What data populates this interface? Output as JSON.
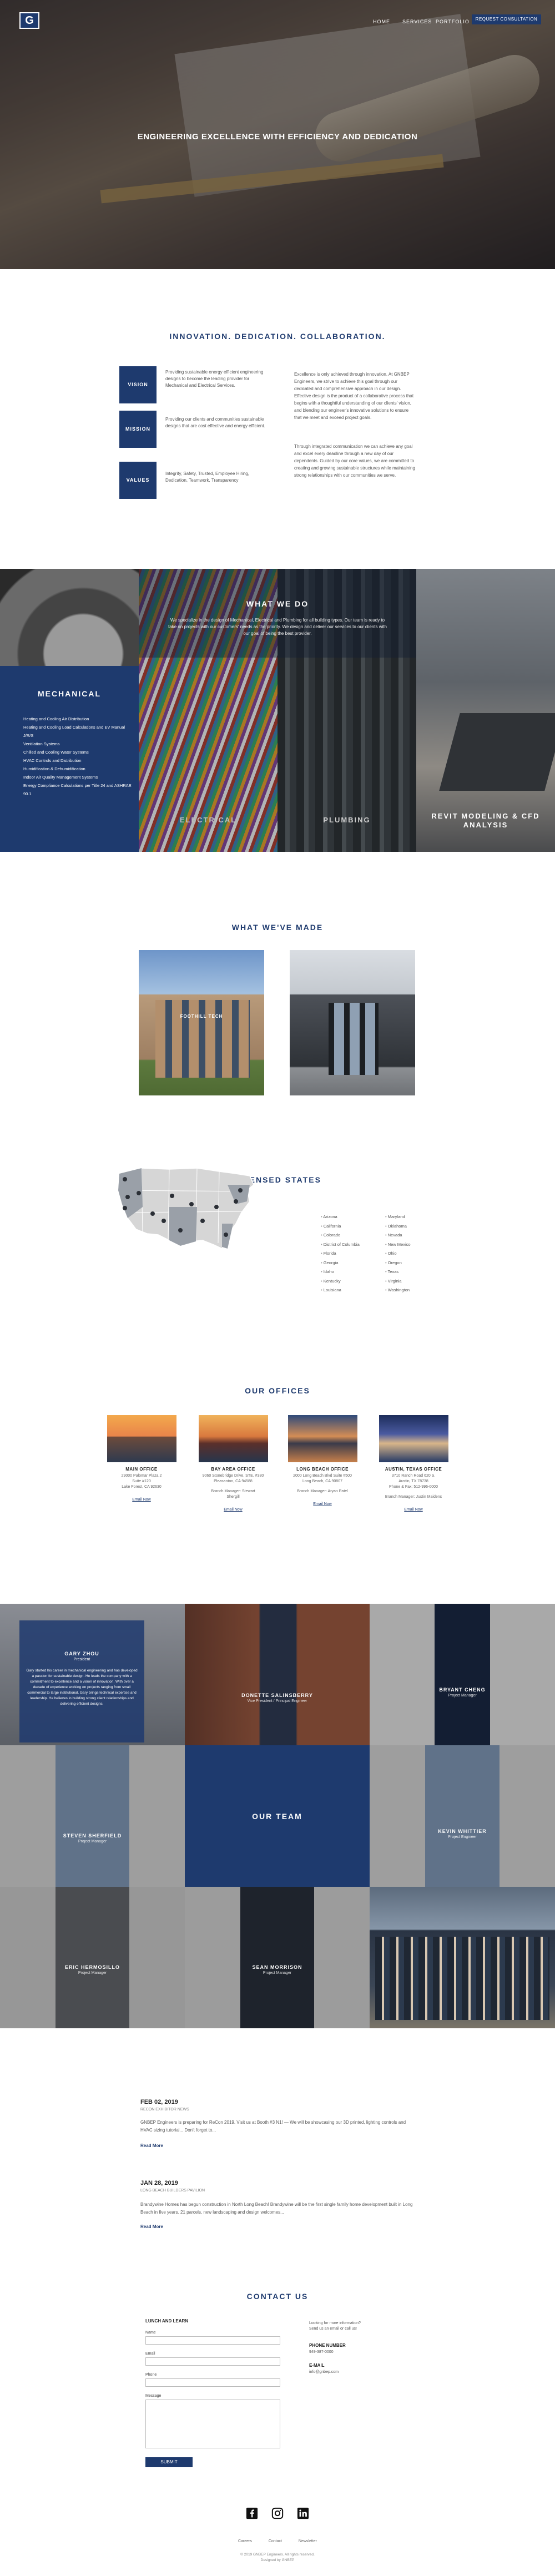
{
  "header": {
    "logo_text": "G",
    "nav": [
      "HOME",
      "SERVICES",
      "PORTFOLIO"
    ],
    "cta": "REQUEST CONSULTATION"
  },
  "hero": {
    "title": "ENGINEERING EXCELLENCE WITH EFFICIENCY AND DEDICATION"
  },
  "intro": {
    "heading": "INNOVATION. DEDICATION. COLLABORATION.",
    "values": [
      {
        "label": "VISION",
        "text": "Providing sustainable energy efficient engineering designs to become the leading provider for Mechanical and Electrical Services."
      },
      {
        "label": "MISSION",
        "text": "Providing our clients and communities sustainable designs that are cost effective and energy efficient."
      },
      {
        "label": "VALUES",
        "text": "Integrity, Safety, Trusted, Employee Hiring, Dedication, Teamwork, Transparency"
      }
    ],
    "paragraph1": "Excellence is only achieved through innovation. At GNBEP Engineers, we strive to achieve this goal through our dedicated and comprehensive approach in our design. Effective design is the product of a collaborative process that begins with a thoughtful understanding of our clients' vision, and blending our engineer's innovative solutions to ensure that we meet and exceed project goals.",
    "paragraph2": "Through integrated communication we can achieve any goal and excel every deadline through a new day of our dependents. Guided by our core values, we are committed to creating and growing sustainable structures while maintaining strong relationships with our communities we serve."
  },
  "services": {
    "heading": "WHAT WE DO",
    "text": "We specialize in the design of Mechanical, Electrical and Plumbing for all building types. Our team is ready to take on projects with our customers' needs as the priority. We design and deliver our services to our clients with our goal of being the best provider.",
    "mechanical": {
      "title": "MECHANICAL",
      "items": [
        "Heating and Cooling Air Distribution",
        "Heating and Cooling Load Calculations and EV Manual J/R/S",
        "Ventilation Systems",
        "Chilled and Cooling Water Systems",
        "HVAC Controls and Distribution",
        "Humidification & Dehumidification",
        "Indoor Air Quality Management Systems",
        "Energy Compliance Calculations per Title 24 and ASHRAE 90.1"
      ]
    },
    "tiles": [
      "ELECTRICAL",
      "PLUMBING",
      "REVIT MODELING & CFD ANALYSIS"
    ]
  },
  "projects": {
    "heading": "WHAT WE'VE MADE",
    "items": [
      {
        "caption": "FOOTHILL TECH"
      },
      {
        "caption": ""
      }
    ]
  },
  "states": {
    "heading": "LICENSED STATES",
    "col1": [
      "Arizona",
      "California",
      "Colorado",
      "District of Columbia",
      "Florida",
      "Georgia",
      "Idaho",
      "Kentucky",
      "Louisiana"
    ],
    "col2": [
      "Maryland",
      "Oklahoma",
      "Nevada",
      "New Mexico",
      "Ohio",
      "Oregon",
      "Texas",
      "Virginia",
      "Washington"
    ]
  },
  "offices": {
    "heading": "OUR OFFICES",
    "items": [
      {
        "name": "MAIN OFFICE",
        "address": [
          "29000 Palomar Plaza 2",
          "Suite #120",
          "Lake Forest, CA 92630"
        ],
        "contact": [],
        "link": "Email Now"
      },
      {
        "name": "BAY AREA OFFICE",
        "address": [
          "9060 Stonebridge Drive, STE. #330",
          "Pleasanton, CA 94588"
        ],
        "contact": [
          "Branch Manager: Stewart",
          "Shergill"
        ],
        "link": "Email Now"
      },
      {
        "name": "LONG BEACH OFFICE",
        "address": [
          "2000 Long Beach Blvd Suite #500",
          "Long Beach, CA 90807"
        ],
        "contact": [
          "Branch Manager: Aryan Patel"
        ],
        "link": "Email Now"
      },
      {
        "name": "AUSTIN, TEXAS OFFICE",
        "address": [
          "3710 Ranch Road 620 S.",
          "Austin, TX 78738",
          "Phone & Fax: 512-996-0000"
        ],
        "contact": [
          "Branch Manager: Justin Maidens"
        ],
        "link": "Email Now"
      }
    ]
  },
  "team": {
    "heading": "OUR TEAM",
    "intro": {
      "name": "GARY ZHOU",
      "role": "President",
      "bio": "Gary started his career in mechanical engineering and has developed a passion for sustainable design. He leads the company with a commitment to excellence and a vision of innovation. With over a decade of experience working on projects ranging from small commercial to large institutional, Gary brings technical expertise and leadership. He believes in building strong client relationships and delivering efficient designs."
    },
    "members": [
      {
        "name": "DONETTE SALINSBERRY",
        "role": "Vice President / Principal Engineer"
      },
      {
        "name": "BRYANT CHENG",
        "role": "Project Manager"
      },
      {
        "name": "STEVEN SHERFIELD",
        "role": "Project Manager"
      },
      {
        "name": "KEVIN WHITTIER",
        "role": "Project Engineer"
      },
      {
        "name": "ERIC HERMOSILLO",
        "role": "Project Manager"
      },
      {
        "name": "SEAN MORRISON",
        "role": "Project Manager"
      }
    ]
  },
  "news": [
    {
      "date": "FEB 02, 2019",
      "sub": "RECON EXHIBITOR NEWS",
      "body": "GNBEP Engineers is preparing for ReCon 2019. Visit us at Booth #3 N1! — We will be showcasing our 3D printed, lighting controls and HVAC sizing tutorial... Don't forget to...",
      "more": "Read More"
    },
    {
      "date": "JAN 28, 2019",
      "sub": "LONG BEACH BUILDERS PAVILION",
      "body": "Brandywine Homes has begun construction in North Long Beach! Brandywine will be the first single family home development built in Long Beach in five years. 21 parcels, new landscaping and design welcomes...",
      "more": "Read More"
    }
  ],
  "contact": {
    "heading": "CONTACT US",
    "form_title": "LUNCH AND LEARN",
    "fields": [
      "Name",
      "Email",
      "Phone",
      "Message"
    ],
    "submit": "SUBMIT",
    "side_intro": [
      "Looking for more information?",
      "Send us an email or call us!"
    ],
    "phone_label": "PHONE NUMBER",
    "phone": "949-387-0000",
    "email_label": "E-MAIL",
    "email": "info@gnbep.com"
  },
  "footer": {
    "social_icons": [
      "facebook-icon",
      "instagram-icon",
      "linkedin-icon"
    ],
    "links": [
      "Careers",
      "Contact",
      "Newsletter"
    ],
    "copyright": "© 2019 GNBEP Engineers. All rights reserved.",
    "credit": "Designed by GNBEP"
  },
  "colors": {
    "brand": "#1e3a6e",
    "text": "#333333"
  }
}
